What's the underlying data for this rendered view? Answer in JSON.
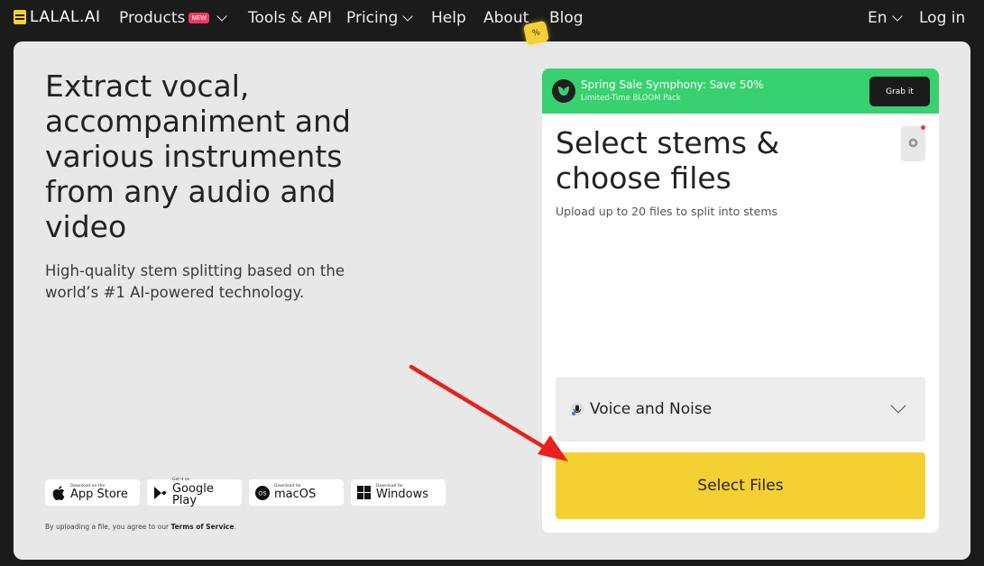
{
  "nav": {
    "logo": "LALAL.AI",
    "products": "Products",
    "products_badge": "NEW",
    "tools": "Tools & API",
    "pricing": "Pricing",
    "help": "Help",
    "about": "About",
    "blog": "Blog",
    "language": "En",
    "login": "Log in"
  },
  "hero": {
    "title": "Extract vocal, accompaniment and various instruments from any audio and video",
    "subtitle": "High-quality stem splitting based on the world’s #1 AI-powered technology."
  },
  "stores": [
    {
      "small": "Download on the",
      "big": "App Store",
      "icon": "apple-icon"
    },
    {
      "small": "Get it on",
      "big": "Google Play",
      "icon": "google-play-icon"
    },
    {
      "small": "Download for",
      "big": "macOS",
      "icon": "macos-icon"
    },
    {
      "small": "Download for",
      "big": "Windows",
      "icon": "windows-icon"
    }
  ],
  "tos": {
    "prefix": "By uploading a file, you agree to our ",
    "link": "Terms of Service",
    "suffix": "."
  },
  "promo": {
    "badge": "%",
    "title": "Spring Sale Symphony: Save 50%",
    "subtitle": "Limited-Time BLOOM Pack",
    "button": "Grab it",
    "color": "#38d16f"
  },
  "panel": {
    "title": "Select stems & choose files",
    "subtitle": "Upload up to 20 files to split into stems",
    "stem_selected": "Voice and Noise",
    "select_button": "Select Files"
  },
  "colors": {
    "accent": "#f5d033",
    "background": "#1c1b1b",
    "card": "#e8e8e8",
    "annotation_arrow": "#e8201e"
  }
}
